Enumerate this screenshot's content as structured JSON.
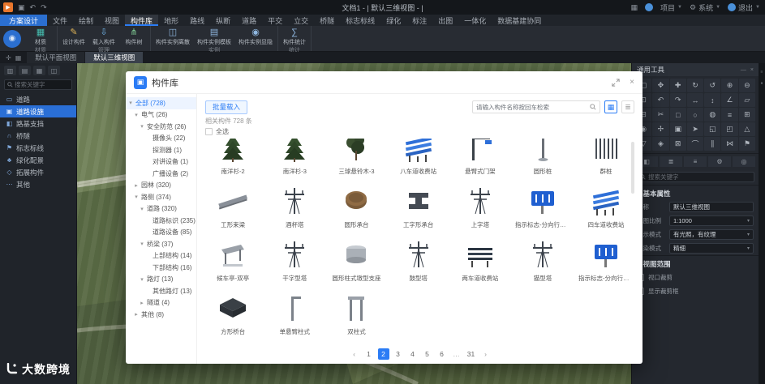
{
  "titlebar": {
    "title": "文档1 - | 默认三维视图 - |",
    "left_icons": [
      {
        "name": "app-logo",
        "glyph": "▶"
      },
      {
        "name": "save-icon",
        "glyph": "▣"
      },
      {
        "name": "undo-icon",
        "glyph": "↶"
      },
      {
        "name": "redo-icon",
        "glyph": "↷"
      }
    ],
    "right": {
      "apps_glyph": "▦",
      "project_label": "项目",
      "gear_glyph": "⚙",
      "system_label": "系统",
      "user_label": "退出"
    }
  },
  "ribbon_tabs": {
    "app_button": "方案设计",
    "tabs": [
      {
        "label": "文件"
      },
      {
        "label": "绘制"
      },
      {
        "label": "视图"
      },
      {
        "label": "构件库",
        "active": true
      },
      {
        "label": "地形"
      },
      {
        "label": "路线"
      },
      {
        "label": "纵断"
      },
      {
        "label": "道路"
      },
      {
        "label": "平交"
      },
      {
        "label": "立交"
      },
      {
        "label": "桥隧"
      },
      {
        "label": "标志标线"
      },
      {
        "label": "绿化"
      },
      {
        "label": "标注"
      },
      {
        "label": "出图"
      },
      {
        "label": "一体化"
      },
      {
        "label": "数据基建协同"
      }
    ]
  },
  "ribbon": {
    "groups": [
      {
        "label": "材质",
        "items": [
          {
            "label": "材质",
            "icon": "material-icon",
            "glyph": "▦",
            "color": "#46c0b2"
          }
        ]
      },
      {
        "label": "管理",
        "items": [
          {
            "label": "设计构件",
            "icon": "design-component-icon",
            "glyph": "✎",
            "color": "#e0b457"
          },
          {
            "label": "载入构件",
            "icon": "load-component-icon",
            "glyph": "⇩",
            "color": "#6fb3e8"
          },
          {
            "label": "构件树",
            "icon": "component-tree-icon",
            "glyph": "⋔",
            "color": "#7cc690"
          }
        ]
      },
      {
        "label": "实例",
        "items": [
          {
            "label": "构件实例离散",
            "icon": "instance-explode-icon",
            "glyph": "◫",
            "color": "#8fb7e0"
          },
          {
            "label": "构件实例模板",
            "icon": "instance-template-icon",
            "glyph": "▤",
            "color": "#8fb7e0"
          },
          {
            "label": "构件实例显隐",
            "icon": "instance-visibility-icon",
            "glyph": "◉",
            "color": "#8fb7e0"
          }
        ]
      },
      {
        "label": "统计",
        "items": [
          {
            "label": "构件统计",
            "icon": "component-stats-icon",
            "glyph": "∑",
            "color": "#8fb7e0"
          }
        ]
      }
    ]
  },
  "view_tabs": [
    {
      "label": "默认平面视图",
      "active": false
    },
    {
      "label": "默认三维视图",
      "active": true
    }
  ],
  "sidebar": {
    "search_placeholder": "搜索关键字",
    "items": [
      {
        "label": "道路",
        "icon": "road-icon",
        "glyph": "▭",
        "selected": false
      },
      {
        "label": "道路设施",
        "icon": "road-facility-icon",
        "glyph": "▣",
        "selected": true
      },
      {
        "label": "路基支挡",
        "icon": "subgrade-icon",
        "glyph": "◧",
        "selected": false
      },
      {
        "label": "桥隧",
        "icon": "bridge-tunnel-icon",
        "glyph": "∩",
        "selected": false
      },
      {
        "label": "标志标线",
        "icon": "sign-marking-icon",
        "glyph": "⚑",
        "selected": false
      },
      {
        "label": "绿化配景",
        "icon": "greenery-icon",
        "glyph": "♣",
        "selected": false
      },
      {
        "label": "拓展构件",
        "icon": "extension-component-icon",
        "glyph": "◇",
        "selected": false
      },
      {
        "label": "其他",
        "icon": "others-icon",
        "glyph": "⋯",
        "selected": false
      }
    ]
  },
  "dialog": {
    "title": "构件库",
    "batch_load_label": "批量载入",
    "search_placeholder": "请输入构件名称按回车检索",
    "result_count": "相关构件 728 条",
    "select_all_label": "全选",
    "tree": [
      {
        "label": "全部",
        "count": 728,
        "level": 0,
        "caret": "down",
        "selected": true
      },
      {
        "label": "电气",
        "count": 26,
        "level": 1,
        "caret": "down"
      },
      {
        "label": "安全防范",
        "count": 26,
        "level": 2,
        "caret": "down"
      },
      {
        "label": "摄像头",
        "count": 22,
        "level": 3,
        "caret": "none"
      },
      {
        "label": "探测器",
        "count": 1,
        "level": 3,
        "caret": "none"
      },
      {
        "label": "对讲设备",
        "count": 1,
        "level": 3,
        "caret": "none"
      },
      {
        "label": "广播设备",
        "count": 2,
        "level": 3,
        "caret": "none"
      },
      {
        "label": "园林",
        "count": 320,
        "level": 1,
        "caret": "right"
      },
      {
        "label": "路侧",
        "count": 374,
        "level": 1,
        "caret": "down"
      },
      {
        "label": "道路",
        "count": 320,
        "level": 2,
        "caret": "down"
      },
      {
        "label": "道路标识",
        "count": 235,
        "level": 3,
        "caret": "none"
      },
      {
        "label": "道路设备",
        "count": 85,
        "level": 3,
        "caret": "none"
      },
      {
        "label": "桥梁",
        "count": 37,
        "level": 2,
        "caret": "down"
      },
      {
        "label": "上部结构",
        "count": 14,
        "level": 3,
        "caret": "none"
      },
      {
        "label": "下部结构",
        "count": 16,
        "level": 3,
        "caret": "none"
      },
      {
        "label": "路灯",
        "count": 13,
        "level": 2,
        "caret": "down"
      },
      {
        "label": "其他路灯",
        "count": 13,
        "level": 3,
        "caret": "none"
      },
      {
        "label": "隧道",
        "count": 4,
        "level": 2,
        "caret": "right"
      },
      {
        "label": "其他",
        "count": 8,
        "level": 1,
        "caret": "right"
      }
    ],
    "cards": [
      {
        "label": "南洋杉-2",
        "thumb": "tree"
      },
      {
        "label": "南洋杉-3",
        "thumb": "tree"
      },
      {
        "label": "三球悬铃木-3",
        "thumb": "tree2"
      },
      {
        "label": "八车道收费站",
        "thumb": "station"
      },
      {
        "label": "悬臂式门架",
        "thumb": "gantry"
      },
      {
        "label": "圆形桩",
        "thumb": "pole"
      },
      {
        "label": "群桩",
        "thumb": "piles"
      },
      {
        "label": "工形束梁",
        "thumb": "beam"
      },
      {
        "label": "酒杯塔",
        "thumb": "tower"
      },
      {
        "label": "圆形承台",
        "thumb": "disk"
      },
      {
        "label": "工字形承台",
        "thumb": "block"
      },
      {
        "label": "上字塔",
        "thumb": "tower"
      },
      {
        "label": "指示标志-分向行驶车道",
        "thumb": "sign"
      },
      {
        "label": "四车道收费站",
        "thumb": "station"
      },
      {
        "label": "候车亭-双亭",
        "thumb": "shelter"
      },
      {
        "label": "干字型塔",
        "thumb": "tower"
      },
      {
        "label": "圆形柱式墩型支座",
        "thumb": "cylinder"
      },
      {
        "label": "鼓型塔",
        "thumb": "tower"
      },
      {
        "label": "两车道收费站",
        "thumb": "station2"
      },
      {
        "label": "猫型塔",
        "thumb": "tower"
      },
      {
        "label": "指示标志-分向行驶车道",
        "thumb": "sign"
      },
      {
        "label": "方形桥台",
        "thumb": "slab"
      },
      {
        "label": "单悬臂柱式",
        "thumb": "polearm"
      },
      {
        "label": "双柱式",
        "thumb": "poles2"
      }
    ],
    "pagination": {
      "items": [
        "prev",
        "1",
        "2",
        "3",
        "4",
        "5",
        "6",
        "…",
        "31",
        "next"
      ],
      "active": "2"
    }
  },
  "right_panel": {
    "title": "通用工具",
    "tools": [
      {
        "name": "select-tool",
        "glyph": "▢"
      },
      {
        "name": "pan-tool",
        "glyph": "✥"
      },
      {
        "name": "move-tool",
        "glyph": "✚"
      },
      {
        "name": "rotate-tool",
        "glyph": "↻"
      },
      {
        "name": "orbit-tool",
        "glyph": "↺"
      },
      {
        "name": "zoom-in-tool",
        "glyph": "⊕"
      },
      {
        "name": "zoom-out-tool",
        "glyph": "⊖"
      },
      {
        "name": "zoom-extents-tool",
        "glyph": "⊡"
      },
      {
        "name": "view-back-tool",
        "glyph": "↶"
      },
      {
        "name": "view-forward-tool",
        "glyph": "↷"
      },
      {
        "name": "measure-length-tool",
        "glyph": "↔"
      },
      {
        "name": "measure-height-tool",
        "glyph": "↕"
      },
      {
        "name": "measure-angle-tool",
        "glyph": "∠"
      },
      {
        "name": "measure-area-tool",
        "glyph": "▱"
      },
      {
        "name": "section-tool",
        "glyph": "⊟"
      },
      {
        "name": "clip-tool",
        "glyph": "✂"
      },
      {
        "name": "box-tool",
        "glyph": "□"
      },
      {
        "name": "sphere-tool",
        "glyph": "○"
      },
      {
        "name": "cylinder-tool",
        "glyph": "◍"
      },
      {
        "name": "layers-tool",
        "glyph": "≡"
      },
      {
        "name": "grid-tool",
        "glyph": "⊞"
      },
      {
        "name": "snap-tool",
        "glyph": "◉"
      },
      {
        "name": "axis-tool",
        "glyph": "✢"
      },
      {
        "name": "camera-tool",
        "glyph": "▣"
      },
      {
        "name": "walkthrough-tool",
        "glyph": "➤"
      },
      {
        "name": "crop-tool",
        "glyph": "◱"
      },
      {
        "name": "viewport-tool",
        "glyph": "◰"
      },
      {
        "name": "top-view-tool",
        "glyph": "△"
      },
      {
        "name": "bottom-view-tool",
        "glyph": "▽"
      },
      {
        "name": "material-tool",
        "glyph": "◈"
      },
      {
        "name": "section-box-tool",
        "glyph": "⊠"
      },
      {
        "name": "arc-tool",
        "glyph": "⌒"
      },
      {
        "name": "parallel-tool",
        "glyph": "∥"
      },
      {
        "name": "merge-tool",
        "glyph": "⋈"
      },
      {
        "name": "flag-tool",
        "glyph": "⚑"
      }
    ],
    "panel_tabs": [
      {
        "name": "cube-tab-icon",
        "glyph": "◧"
      },
      {
        "name": "list-tab-icon",
        "glyph": "≣"
      },
      {
        "name": "layers-tab-icon",
        "glyph": "≡"
      },
      {
        "name": "settings-tab-icon",
        "glyph": "⚙"
      },
      {
        "name": "info-tab-icon",
        "glyph": "◎"
      }
    ],
    "search_placeholder": "搜索关键字",
    "basic_section": "基本属性",
    "fields": [
      {
        "label": "名称",
        "value": "默认三维视图",
        "type": "input"
      },
      {
        "label": "视图比例",
        "value": "1:1000",
        "type": "select"
      },
      {
        "label": "显示模式",
        "value": "有光照，有纹理",
        "type": "select"
      },
      {
        "label": "渲染模式",
        "value": "精细",
        "type": "select"
      }
    ],
    "range_section": "视图范围",
    "checkboxes": [
      {
        "label": "视口裁剪",
        "checked": false
      },
      {
        "label": "显示裁剪框",
        "checked": false
      }
    ]
  },
  "watermark": {
    "text": "大数跨境"
  },
  "colors": {
    "accent": "#2b7cf5",
    "selection": "#2a6fd6",
    "app_button": "#2b6fd0"
  }
}
